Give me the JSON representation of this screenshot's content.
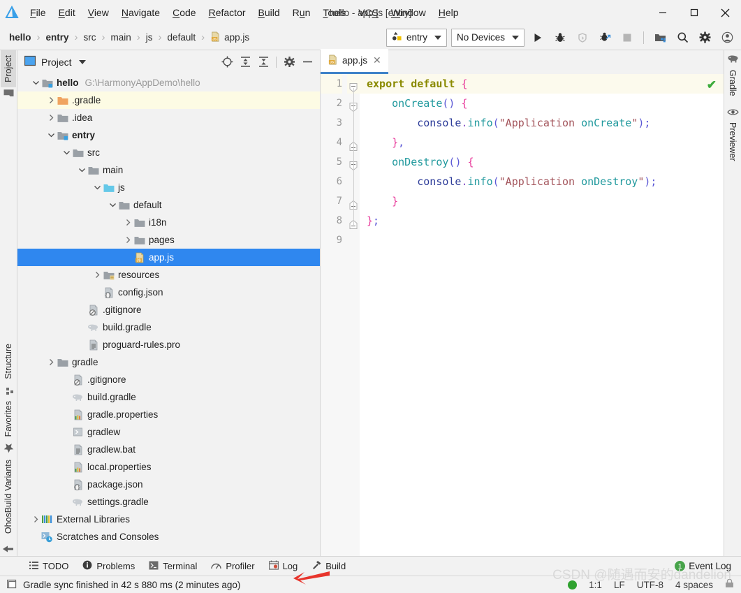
{
  "window": {
    "title": "hello - app.js [entry]",
    "minimize_label": "–",
    "maximize_label": "□",
    "close_label": "✕"
  },
  "menu": {
    "items": [
      {
        "label": "File",
        "mnemonic": "F"
      },
      {
        "label": "Edit",
        "mnemonic": "E"
      },
      {
        "label": "View",
        "mnemonic": "V"
      },
      {
        "label": "Navigate",
        "mnemonic": "N"
      },
      {
        "label": "Code",
        "mnemonic": "C"
      },
      {
        "label": "Refactor",
        "mnemonic": "R"
      },
      {
        "label": "Build",
        "mnemonic": "B"
      },
      {
        "label": "Run",
        "mnemonic": "u"
      },
      {
        "label": "Tools",
        "mnemonic": "T"
      },
      {
        "label": "VCS",
        "mnemonic": "S"
      },
      {
        "label": "Window",
        "mnemonic": "W"
      },
      {
        "label": "Help",
        "mnemonic": "H"
      }
    ]
  },
  "breadcrumb": {
    "items": [
      "hello",
      "entry",
      "src",
      "main",
      "js",
      "default",
      "app.js"
    ],
    "separator": "›"
  },
  "toolbar": {
    "run_config": "entry",
    "device": "No Devices",
    "icons": [
      "run-icon",
      "debug-icon",
      "run-coverage-icon",
      "profile-icon",
      "stop-icon",
      "project-structure-icon",
      "search-everywhere-icon",
      "settings-icon",
      "account-icon"
    ]
  },
  "left_strip": {
    "tabs": [
      "Project",
      "Structure",
      "Favorites",
      "OhosBuild Variants"
    ],
    "selected": "Project"
  },
  "right_strip": {
    "tabs": [
      "Gradle",
      "Previewer"
    ]
  },
  "project_panel": {
    "title": "Project",
    "tools": [
      "locate-icon",
      "expand-all-icon",
      "collapse-all-icon",
      "settings-icon",
      "hide-icon"
    ],
    "tree": [
      {
        "depth": 0,
        "label": "hello",
        "path": "G:\\HarmonyAppDemo\\hello",
        "icon": "module-folder-icon",
        "arrow": "down",
        "bold": true,
        "state": "normal"
      },
      {
        "depth": 1,
        "label": ".gradle",
        "icon": "orange-folder-icon",
        "arrow": "right",
        "bold": false,
        "state": "highlight"
      },
      {
        "depth": 1,
        "label": ".idea",
        "icon": "folder-icon",
        "arrow": "right",
        "bold": false,
        "state": "normal"
      },
      {
        "depth": 1,
        "label": "entry",
        "icon": "module-folder-icon",
        "arrow": "down",
        "bold": true,
        "state": "normal"
      },
      {
        "depth": 2,
        "label": "src",
        "icon": "folder-icon",
        "arrow": "down",
        "bold": false,
        "state": "normal"
      },
      {
        "depth": 3,
        "label": "main",
        "icon": "folder-icon",
        "arrow": "down",
        "bold": false,
        "state": "normal"
      },
      {
        "depth": 4,
        "label": "js",
        "icon": "source-folder-icon",
        "arrow": "down",
        "bold": false,
        "state": "normal"
      },
      {
        "depth": 5,
        "label": "default",
        "icon": "folder-icon",
        "arrow": "down",
        "bold": false,
        "state": "normal"
      },
      {
        "depth": 6,
        "label": "i18n",
        "icon": "folder-icon",
        "arrow": "right",
        "bold": false,
        "state": "normal"
      },
      {
        "depth": 6,
        "label": "pages",
        "icon": "folder-icon",
        "arrow": "right",
        "bold": false,
        "state": "normal"
      },
      {
        "depth": 6,
        "label": "app.js",
        "icon": "js-file-icon",
        "arrow": "none",
        "bold": false,
        "state": "selected"
      },
      {
        "depth": 4,
        "label": "resources",
        "icon": "resource-folder-icon",
        "arrow": "right",
        "bold": false,
        "state": "normal"
      },
      {
        "depth": 4,
        "label": "config.json",
        "icon": "json-file-icon",
        "arrow": "none",
        "bold": false,
        "state": "normal"
      },
      {
        "depth": 3,
        "label": ".gitignore",
        "icon": "gitignore-file-icon",
        "arrow": "none",
        "bold": false,
        "state": "normal"
      },
      {
        "depth": 3,
        "label": "build.gradle",
        "icon": "gradle-file-icon",
        "arrow": "none",
        "bold": false,
        "state": "normal"
      },
      {
        "depth": 3,
        "label": "proguard-rules.pro",
        "icon": "text-file-icon",
        "arrow": "none",
        "bold": false,
        "state": "normal"
      },
      {
        "depth": 1,
        "label": "gradle",
        "icon": "folder-icon",
        "arrow": "right",
        "bold": false,
        "state": "normal"
      },
      {
        "depth": 2,
        "label": ".gitignore",
        "icon": "gitignore-file-icon",
        "arrow": "none",
        "bold": false,
        "state": "normal"
      },
      {
        "depth": 2,
        "label": "build.gradle",
        "icon": "gradle-file-icon",
        "arrow": "none",
        "bold": false,
        "state": "normal"
      },
      {
        "depth": 2,
        "label": "gradle.properties",
        "icon": "properties-file-icon",
        "arrow": "none",
        "bold": false,
        "state": "normal"
      },
      {
        "depth": 2,
        "label": "gradlew",
        "icon": "script-file-icon",
        "arrow": "none",
        "bold": false,
        "state": "normal"
      },
      {
        "depth": 2,
        "label": "gradlew.bat",
        "icon": "text-file-icon",
        "arrow": "none",
        "bold": false,
        "state": "normal"
      },
      {
        "depth": 2,
        "label": "local.properties",
        "icon": "properties-file-icon",
        "arrow": "none",
        "bold": false,
        "state": "normal"
      },
      {
        "depth": 2,
        "label": "package.json",
        "icon": "json-file-icon",
        "arrow": "none",
        "bold": false,
        "state": "normal"
      },
      {
        "depth": 2,
        "label": "settings.gradle",
        "icon": "gradle-file-icon",
        "arrow": "none",
        "bold": false,
        "state": "normal"
      },
      {
        "depth": 0,
        "label": "External Libraries",
        "icon": "libraries-icon",
        "arrow": "right",
        "bold": false,
        "state": "normal"
      },
      {
        "depth": 0,
        "label": "Scratches and Consoles",
        "icon": "scratches-icon",
        "arrow": "none",
        "bold": false,
        "state": "normal"
      }
    ]
  },
  "editor": {
    "tab": {
      "label": "app.js",
      "icon": "js-file-icon",
      "close": "✕"
    },
    "inspection_ok": "✔",
    "lines": [
      {
        "num": "1",
        "text": "export default {",
        "highlight": true
      },
      {
        "num": "2",
        "text": "    onCreate() {",
        "highlight": false
      },
      {
        "num": "3",
        "text": "        console.info(\"Application onCreate\");",
        "highlight": false
      },
      {
        "num": "4",
        "text": "    },",
        "highlight": false
      },
      {
        "num": "5",
        "text": "    onDestroy() {",
        "highlight": false
      },
      {
        "num": "6",
        "text": "        console.info(\"Application onDestroy\");",
        "highlight": false
      },
      {
        "num": "7",
        "text": "    }",
        "highlight": false
      },
      {
        "num": "8",
        "text": "};",
        "highlight": false
      },
      {
        "num": "9",
        "text": "",
        "highlight": false
      }
    ],
    "syntax_colors": {
      "keyword": "#8a8a00",
      "brace": "#e8399a",
      "function": "#20999d",
      "paren": "#5c59d6",
      "object": "#2d3c99",
      "dot": "#8754c9",
      "string": "#a3545b"
    }
  },
  "tool_window_bar": {
    "items": [
      {
        "label": "TODO",
        "icon": "todo-icon"
      },
      {
        "label": "Problems",
        "icon": "problems-icon"
      },
      {
        "label": "Terminal",
        "icon": "terminal-icon"
      },
      {
        "label": "Profiler",
        "icon": "profiler-icon"
      },
      {
        "label": "Log",
        "icon": "log-icon"
      },
      {
        "label": "Build",
        "icon": "build-icon"
      }
    ],
    "event_log": {
      "label": "Event Log",
      "count": "1"
    }
  },
  "status_bar": {
    "message": "Gradle sync finished in 42 s 880 ms (2 minutes ago)",
    "caret": "1:1",
    "line_separator": "LF",
    "encoding": "UTF-8",
    "indent": "4 spaces"
  },
  "watermark": "CSDN @随遇而安的dandelion",
  "colors": {
    "accent": "#2f87ef",
    "tab_underline": "#4083c9",
    "highlight_row": "#fdfbe4",
    "chrome_bg": "#f2f2f2",
    "arrow_red": "#e8352c"
  }
}
